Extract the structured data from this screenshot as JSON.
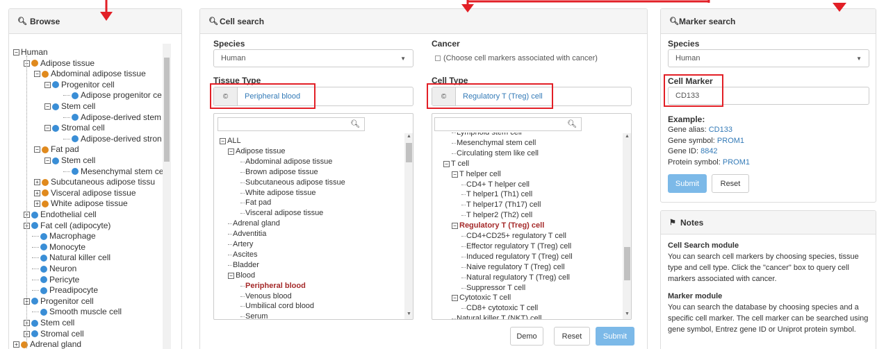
{
  "browse": {
    "title": "Browse",
    "tree": [
      {
        "label": "Human",
        "toggle": "−",
        "icon": "none"
      },
      {
        "label": "Adipose tissue",
        "toggle": "−",
        "icon": "o"
      },
      {
        "label": "Abdominal adipose tissue",
        "toggle": "−",
        "icon": "o"
      },
      {
        "label": "Progenitor cell",
        "toggle": "−",
        "icon": "b"
      },
      {
        "label": "Adipose progenitor ce",
        "toggle": "",
        "icon": "b"
      },
      {
        "label": "Stem cell",
        "toggle": "−",
        "icon": "b"
      },
      {
        "label": "Adipose-derived stem",
        "toggle": "",
        "icon": "b"
      },
      {
        "label": "Stromal cell",
        "toggle": "−",
        "icon": "b"
      },
      {
        "label": "Adipose-derived stron",
        "toggle": "",
        "icon": "b"
      },
      {
        "label": "Fat pad",
        "toggle": "−",
        "icon": "o"
      },
      {
        "label": "Stem cell",
        "toggle": "−",
        "icon": "b"
      },
      {
        "label": "Mesenchymal stem ce",
        "toggle": "",
        "icon": "b"
      },
      {
        "label": "Subcutaneous adipose tissu",
        "toggle": "+",
        "icon": "o"
      },
      {
        "label": "Visceral adipose tissue",
        "toggle": "+",
        "icon": "o"
      },
      {
        "label": "White adipose tissue",
        "toggle": "+",
        "icon": "o"
      },
      {
        "label": "Endothelial cell",
        "toggle": "+",
        "icon": "b"
      },
      {
        "label": "Fat cell (adipocyte)",
        "toggle": "+",
        "icon": "b"
      },
      {
        "label": "Macrophage",
        "toggle": "",
        "icon": "b"
      },
      {
        "label": "Monocyte",
        "toggle": "",
        "icon": "b"
      },
      {
        "label": "Natural killer cell",
        "toggle": "",
        "icon": "b"
      },
      {
        "label": "Neuron",
        "toggle": "",
        "icon": "b"
      },
      {
        "label": "Pericyte",
        "toggle": "",
        "icon": "b"
      },
      {
        "label": "Preadipocyte",
        "toggle": "",
        "icon": "b"
      },
      {
        "label": "Progenitor cell",
        "toggle": "+",
        "icon": "b"
      },
      {
        "label": "Smooth muscle cell",
        "toggle": "",
        "icon": "b"
      },
      {
        "label": "Stem cell",
        "toggle": "+",
        "icon": "b"
      },
      {
        "label": "Stromal cell",
        "toggle": "+",
        "icon": "b"
      },
      {
        "label": "Adrenal gland",
        "toggle": "+",
        "icon": "o"
      }
    ]
  },
  "cell_search": {
    "title": "Cell search",
    "species_label": "Species",
    "species_value": "Human",
    "cancer_label": "Cancer",
    "cancer_checkbox_text": "(Choose cell markers associated with cancer)",
    "tissue_label": "Tissue Type",
    "tissue_value": "Peripheral blood",
    "celltype_label": "Cell Type",
    "celltype_value": "Regulatory T (Treg) cell",
    "tissue_tree": [
      {
        "label": "ALL",
        "toggle": "−",
        "style": "normal"
      },
      {
        "label": "Adipose tissue",
        "toggle": "−",
        "style": "normal"
      },
      {
        "label": "Abdominal adipose tissue",
        "toggle": "",
        "style": "normal"
      },
      {
        "label": "Brown adipose tissue",
        "toggle": "",
        "style": "normal"
      },
      {
        "label": "Subcutaneous adipose tissue",
        "toggle": "",
        "style": "normal"
      },
      {
        "label": "White adipose tissue",
        "toggle": "",
        "style": "normal"
      },
      {
        "label": "Fat pad",
        "toggle": "",
        "style": "normal"
      },
      {
        "label": "Visceral adipose tissue",
        "toggle": "",
        "style": "normal"
      },
      {
        "label": "Adrenal gland",
        "toggle": "",
        "style": "normal"
      },
      {
        "label": "Adventitia",
        "toggle": "",
        "style": "normal"
      },
      {
        "label": "Artery",
        "toggle": "",
        "style": "normal"
      },
      {
        "label": "Ascites",
        "toggle": "",
        "style": "normal"
      },
      {
        "label": "Bladder",
        "toggle": "",
        "style": "normal"
      },
      {
        "label": "Blood",
        "toggle": "−",
        "style": "normal"
      },
      {
        "label": "Peripheral blood",
        "toggle": "",
        "style": "selected"
      },
      {
        "label": "Venous blood",
        "toggle": "",
        "style": "normal"
      },
      {
        "label": "Umbilical cord blood",
        "toggle": "",
        "style": "normal"
      },
      {
        "label": "Serum",
        "toggle": "",
        "style": "normal"
      }
    ],
    "cell_tree": [
      {
        "label": "Lymphoid stem cell",
        "toggle": "",
        "style": "cut"
      },
      {
        "label": "Mesenchymal stem cell",
        "toggle": "",
        "style": "normal"
      },
      {
        "label": "Circulating stem like cell",
        "toggle": "",
        "style": "normal"
      },
      {
        "label": "T cell",
        "toggle": "−",
        "style": "normal"
      },
      {
        "label": "T helper cell",
        "toggle": "−",
        "style": "normal"
      },
      {
        "label": "CD4+ T helper cell",
        "toggle": "",
        "style": "normal"
      },
      {
        "label": "T helper1 (Th1) cell",
        "toggle": "",
        "style": "normal"
      },
      {
        "label": "T helper17 (Th17) cell",
        "toggle": "",
        "style": "normal"
      },
      {
        "label": "T helper2 (Th2) cell",
        "toggle": "",
        "style": "normal"
      },
      {
        "label": "Regulatory T (Treg) cell",
        "toggle": "−",
        "style": "selected"
      },
      {
        "label": "CD4+CD25+ regulatory T cell",
        "toggle": "",
        "style": "normal"
      },
      {
        "label": "Effector regulatory T (Treg) cell",
        "toggle": "",
        "style": "normal"
      },
      {
        "label": "Induced regulatory T (Treg) cell",
        "toggle": "",
        "style": "normal"
      },
      {
        "label": "Naive regulatory T (Treg) cell",
        "toggle": "",
        "style": "normal"
      },
      {
        "label": "Natural regulatory T (Treg) cell",
        "toggle": "",
        "style": "normal"
      },
      {
        "label": "Suppressor T cell",
        "toggle": "",
        "style": "normal"
      },
      {
        "label": "Cytotoxic T cell",
        "toggle": "−",
        "style": "normal"
      },
      {
        "label": "CD8+ cytotoxic T cell",
        "toggle": "",
        "style": "normal"
      },
      {
        "label": "Natural killer T (NKT) cell",
        "toggle": "",
        "style": "normal"
      }
    ],
    "demo_button": "Demo",
    "reset_button": "Reset",
    "submit_button": "Submit"
  },
  "marker_search": {
    "title": "Marker search",
    "species_label": "Species",
    "species_value": "Human",
    "cell_marker_label": "Cell Marker",
    "cell_marker_value": "CD133",
    "example_label": "Example:",
    "examples": [
      {
        "key": "Gene alias: ",
        "value": "CD133"
      },
      {
        "key": "Gene symbol: ",
        "value": "PROM1"
      },
      {
        "key": "Gene ID: ",
        "value": "8842"
      },
      {
        "key": "Protein symbol: ",
        "value": "PROM1"
      }
    ],
    "submit_button": "Submit",
    "reset_button": "Reset"
  },
  "notes": {
    "title": "Notes",
    "cell_module_title": "Cell Search module",
    "cell_module_text": "You can search cell markers by choosing species, tissue type and cell type. Click the \"cancer\" box to query cell markers associated with cancer.",
    "marker_module_title": "Marker module",
    "marker_module_text": "You can search the database by choosing species and a specific cell marker. The cell marker can be searched using gene symbol, Entrez gene ID or Uniprot protein symbol."
  },
  "colors": {
    "annotation_red": "#e21f26",
    "link_blue": "#337ab7",
    "selected_text": "#a52a2a",
    "primary_button": "#7cb9e8"
  }
}
